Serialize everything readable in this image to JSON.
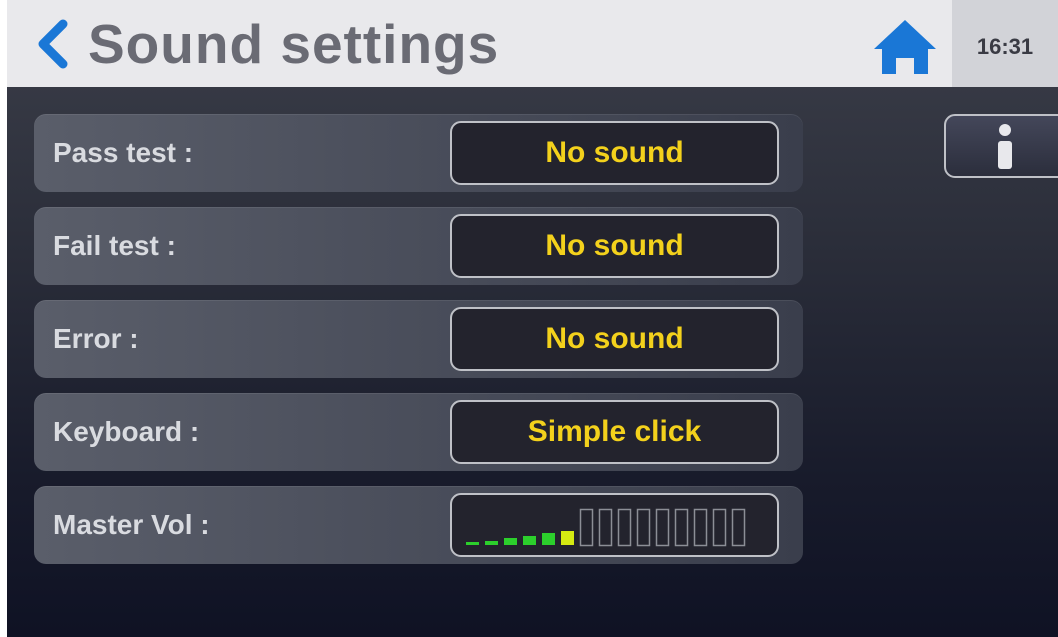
{
  "header": {
    "title": "Sound settings",
    "time": "16:31"
  },
  "settings": [
    {
      "label": "Pass test :",
      "value": "No sound"
    },
    {
      "label": "Fail test :",
      "value": "No sound"
    },
    {
      "label": "Error :",
      "value": "No sound"
    },
    {
      "label": "Keyboard :",
      "value": "Simple click"
    }
  ],
  "master_volume": {
    "label": "Master Vol :",
    "level": 6,
    "max": 15
  },
  "icons": {
    "back": "chevron-left-icon",
    "home": "home-icon",
    "info": "info-icon"
  },
  "colors": {
    "accent_blue": "#1a77d6",
    "value_text": "#f3d11c",
    "volume_active": "#d5ea12",
    "volume_low": "#2ccf2c"
  }
}
